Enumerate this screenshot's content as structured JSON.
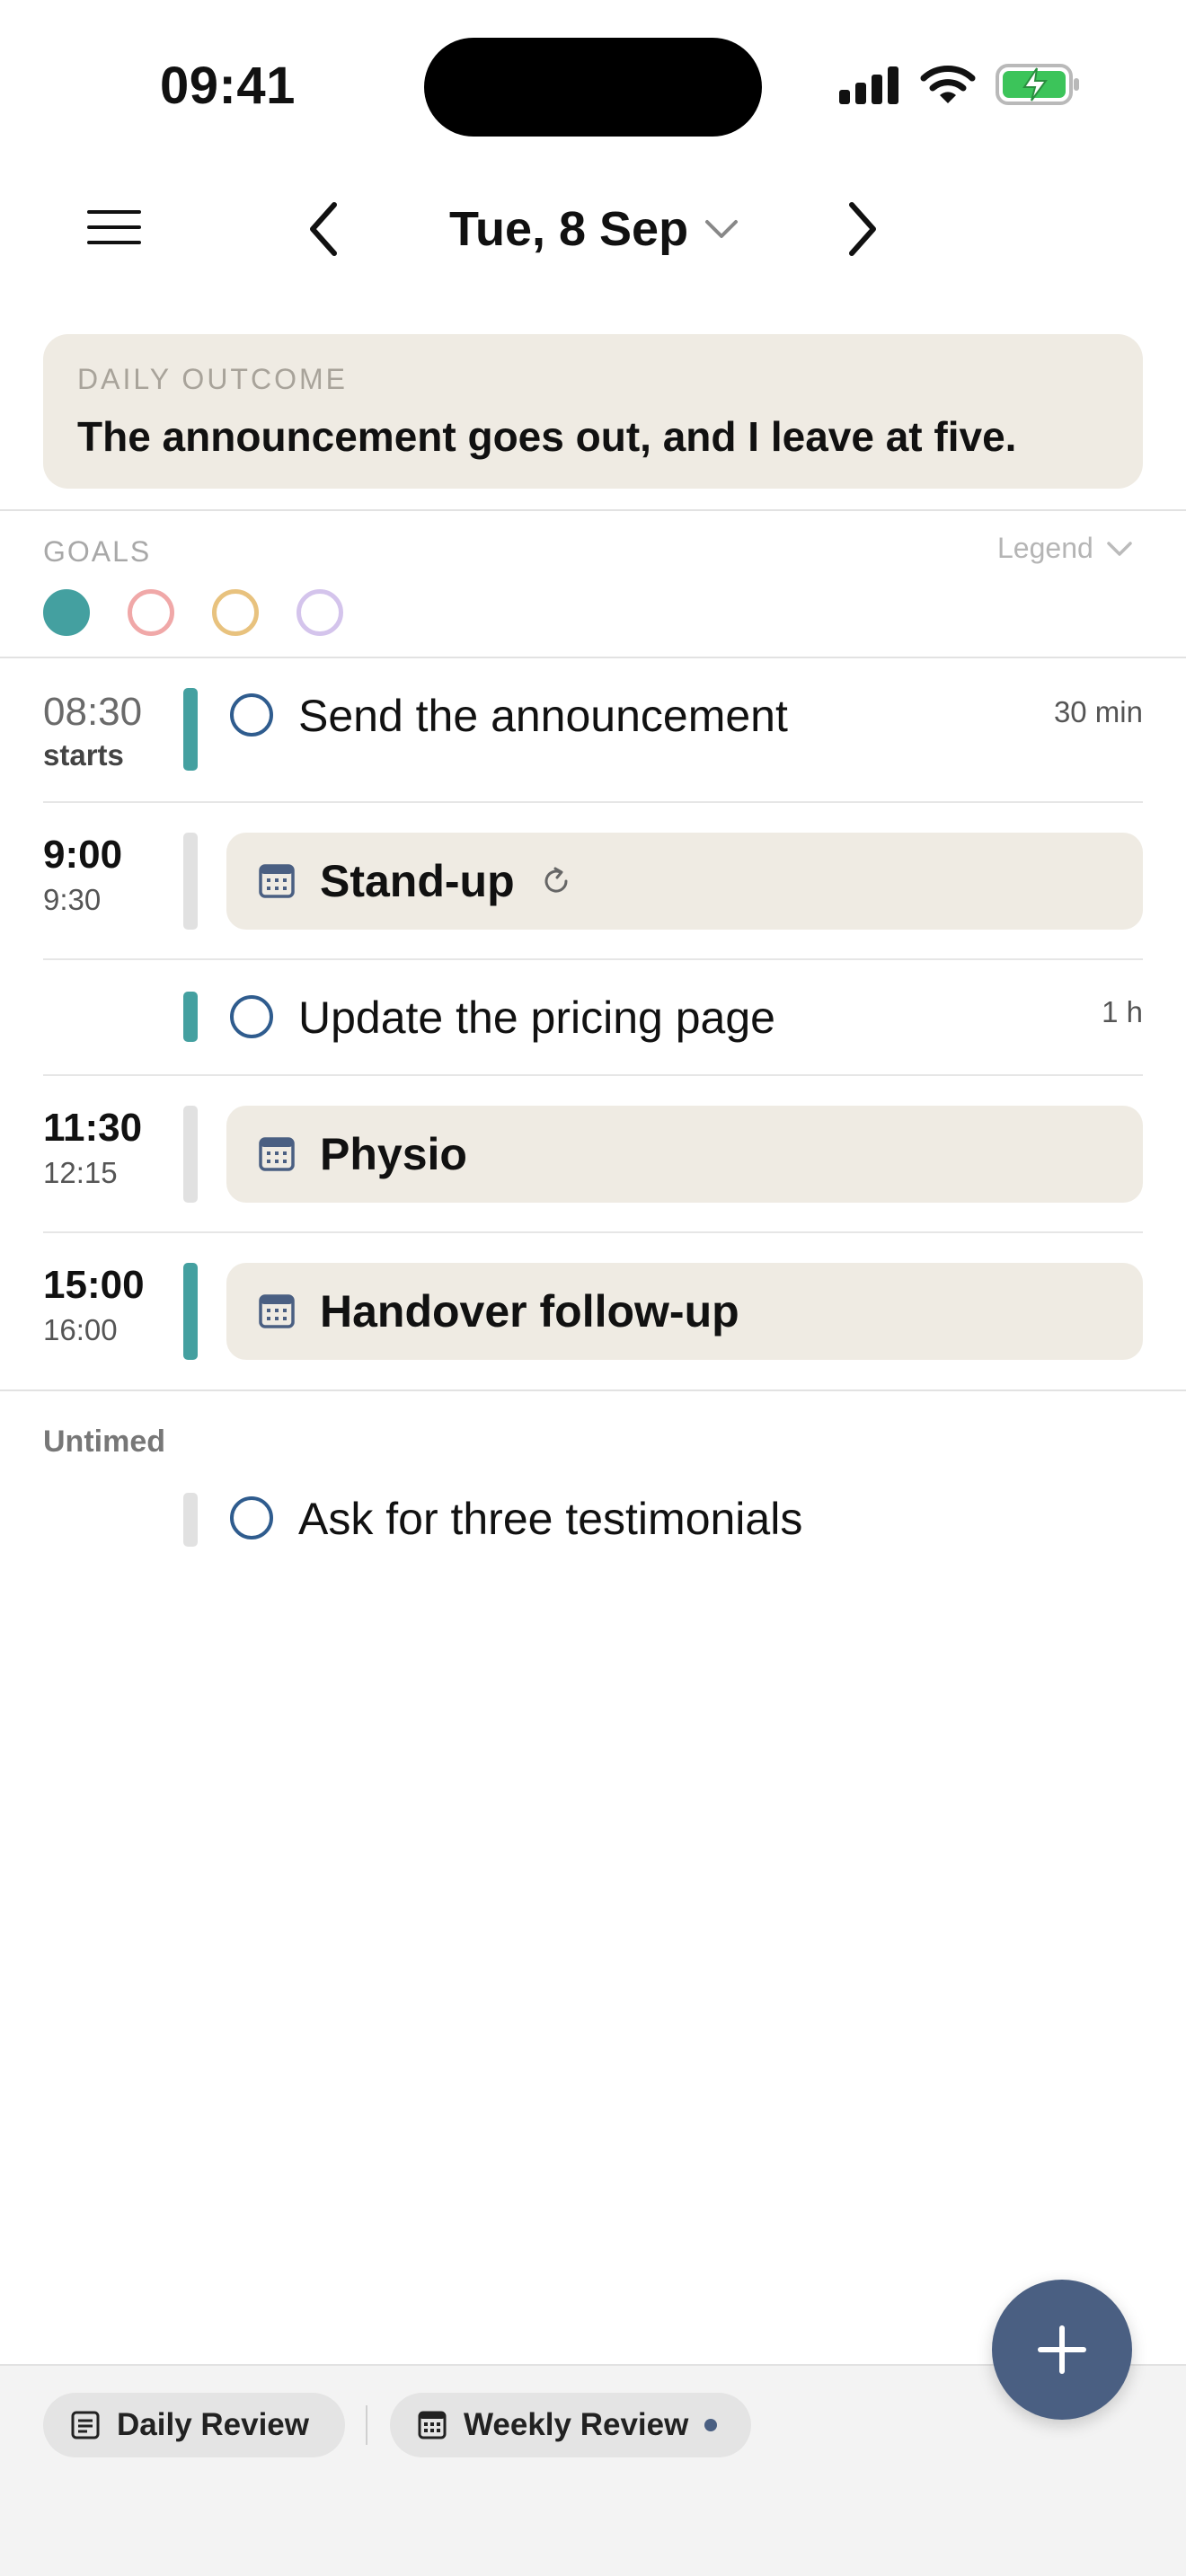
{
  "status_bar": {
    "time": "09:41"
  },
  "nav": {
    "date": "Tue, 8 Sep",
    "menu_icon": "hamburger-icon",
    "prev_icon": "chevron-left-icon",
    "next_icon": "chevron-right-icon",
    "dropdown_icon": "chevron-down-icon"
  },
  "outcome": {
    "eyebrow": "DAILY OUTCOME",
    "text": "The announcement goes out, and I leave at five."
  },
  "goals": {
    "label": "GOALS",
    "legend_label": "Legend",
    "dots": [
      {
        "color": "#44a0a0",
        "filled": true
      },
      {
        "color": "#f0a8a8",
        "filled": false
      },
      {
        "color": "#e8c27e",
        "filled": false
      },
      {
        "color": "#d4c4ec",
        "filled": false
      }
    ]
  },
  "schedule": {
    "task1": {
      "time": "08:30",
      "sub": "starts",
      "title": "Send the announcement",
      "duration": "30 min"
    },
    "event1": {
      "start": "9:00",
      "end": "9:30",
      "title": "Stand-up",
      "recurring_icon": "repeat-icon"
    },
    "task2": {
      "title": "Update the pricing page",
      "duration": "1 h"
    },
    "event2": {
      "start": "11:30",
      "end": "12:15",
      "title": "Physio"
    },
    "event3": {
      "start": "15:00",
      "end": "16:00",
      "title": "Handover follow-up"
    }
  },
  "untimed": {
    "label": "Untimed",
    "task": {
      "title": "Ask for three testimonials"
    }
  },
  "fab": {
    "icon": "plus-icon"
  },
  "bottom": {
    "daily_review": "Daily Review",
    "weekly_review": "Weekly Review"
  },
  "colors": {
    "accent": "#4a5f82",
    "teal": "#44a0a0",
    "card": "#efebe3",
    "check": "#2f5c8e"
  }
}
